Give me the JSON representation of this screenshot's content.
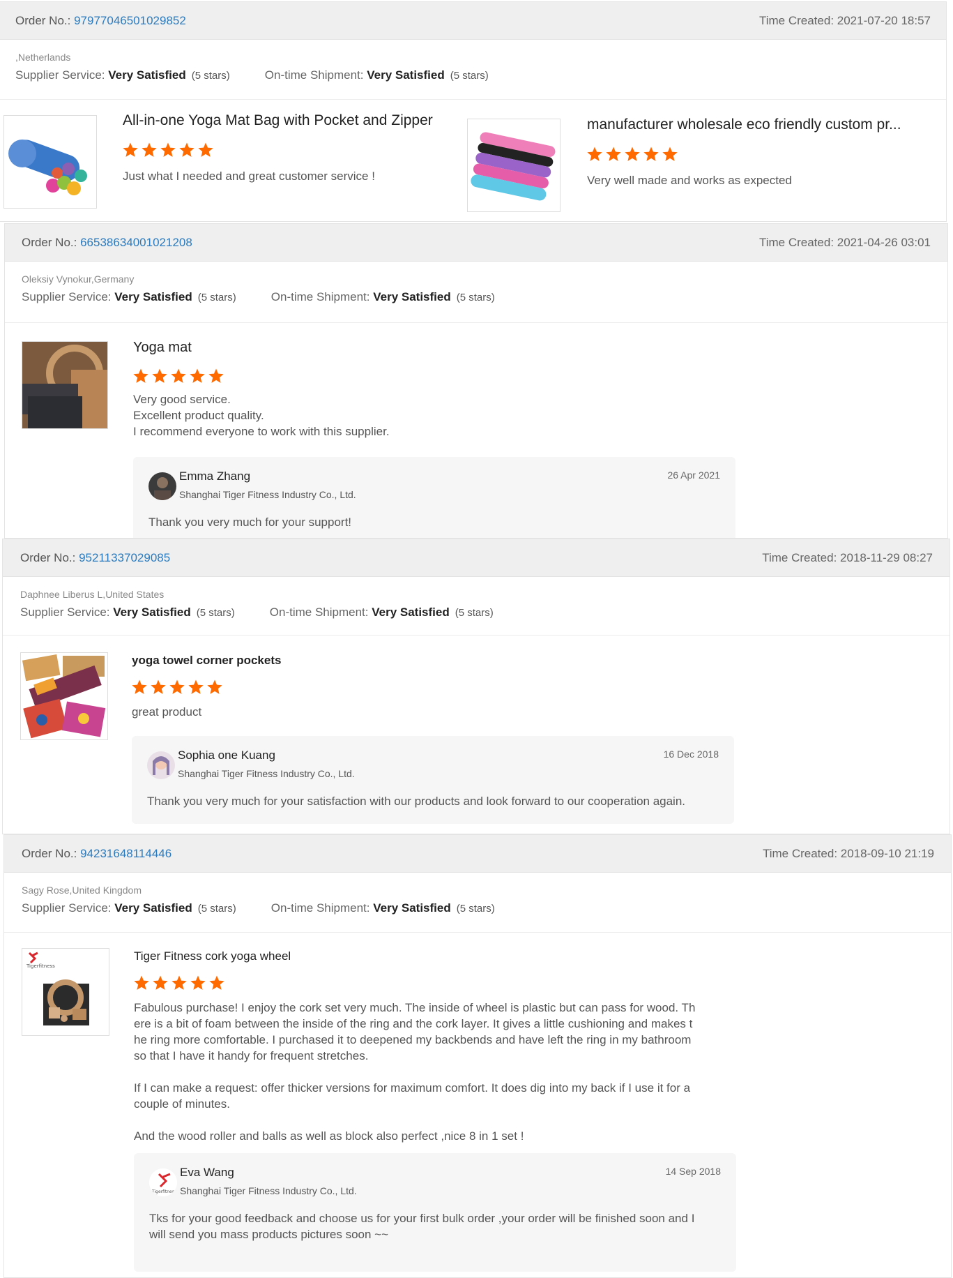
{
  "labels": {
    "order_no": "Order No.: ",
    "time_created": "Time Created: ",
    "supplier_service": "Supplier Service: ",
    "ontime_shipment": "On-time Shipment: ",
    "very_satisfied": "Very Satisfied",
    "five_stars": "(5 stars)"
  },
  "colors": {
    "star": "#ff6a00",
    "link": "#2a7bbf",
    "header_bg": "#efefef",
    "reply_bg": "#f6f6f7"
  },
  "reviews": [
    {
      "order_no": "97977046501029852",
      "time": "2021-07-20 18:57",
      "buyer": ",Netherlands",
      "supplier_rating_stars": 5,
      "shipment_rating_stars": 5,
      "products": [
        {
          "title": "All-in-one Yoga Mat Bag with Pocket and Zipper",
          "stars": 5,
          "text": "Just what I needed and great customer service !"
        },
        {
          "title": "manufacturer wholesale eco friendly custom pr...",
          "stars": 5,
          "text": "Very well made and works as expected"
        }
      ]
    },
    {
      "order_no": "66538634001021208",
      "time": "2021-04-26 03:01",
      "buyer": "Oleksiy Vynokur,Germany",
      "supplier_rating_stars": 5,
      "shipment_rating_stars": 5,
      "product": {
        "title": "Yoga mat",
        "stars": 5,
        "lines": [
          "Very good service.",
          "Excellent product quality.",
          "I recommend everyone to work with this supplier."
        ]
      },
      "reply": {
        "name": "Emma Zhang",
        "company": "Shanghai Tiger Fitness Industry Co., Ltd.",
        "date": "26 Apr 2021",
        "message": "Thank you very much for your support!"
      }
    },
    {
      "order_no": "95211337029085",
      "time": "2018-11-29 08:27",
      "buyer": "Daphnee Liberus L,United States",
      "supplier_rating_stars": 5,
      "shipment_rating_stars": 5,
      "product": {
        "title": "yoga towel corner pockets",
        "stars": 5,
        "text": "great product"
      },
      "reply": {
        "name": "Sophia one Kuang",
        "company": "Shanghai Tiger Fitness Industry Co., Ltd.",
        "date": "16 Dec 2018",
        "message": "Thank you very much for your satisfaction with our products and look forward to our cooperation again."
      }
    },
    {
      "order_no": "94231648114446",
      "time": "2018-09-10 21:19",
      "buyer": "Sagy Rose,United Kingdom",
      "supplier_rating_stars": 5,
      "shipment_rating_stars": 5,
      "product": {
        "title": "Tiger Fitness cork yoga wheel",
        "stars": 5,
        "thumb_brand": "Tigerfitness",
        "lines": [
          "Fabulous purchase! I enjoy the cork set very much. The inside of wheel is plastic but can pass for wood. Th",
          "ere is a bit of foam between the inside of the ring and the cork layer. It gives a little cushioning and makes t",
          "he ring more comfortable. I purchased it to deepened my backbends and have left the ring in my bathroom",
          "so that I have it handy for frequent stretches.",
          "",
          "If I can make a request: offer thicker versions for maximum comfort. It does dig into my back if I use it for a",
          "couple of minutes.",
          "",
          "And the wood roller and balls as well as block also perfect ,nice 8 in 1 set !"
        ]
      },
      "reply": {
        "name": "Eva Wang",
        "company": "Shanghai Tiger Fitness Industry Co., Ltd.",
        "date": "14 Sep 2018",
        "avatar_brand": "Tigerfitness",
        "lines": [
          "Tks for your good feedback and choose us for your first bulk order ,your order will be finished  soon and I",
          "will send you mass products pictures soon ~~"
        ]
      }
    }
  ]
}
